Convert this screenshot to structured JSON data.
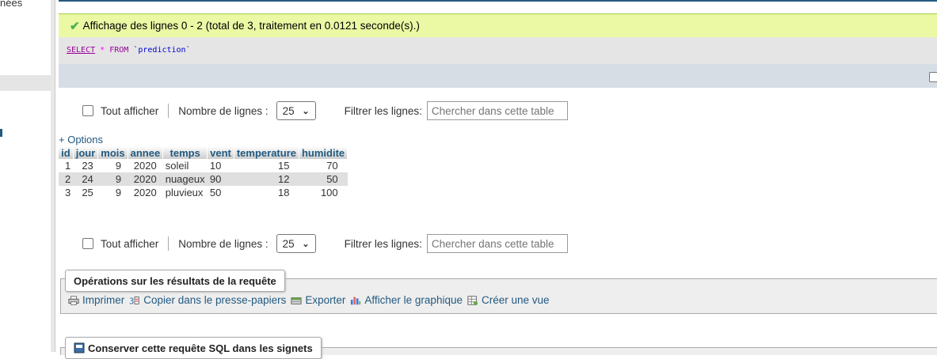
{
  "sidebar": {
    "partial_text": "nées"
  },
  "message": {
    "text": "Affichage des lignes 0 - 2 (total de 3, traitement en 0.0121 seconde(s).)"
  },
  "sql": {
    "select": "SELECT",
    "star": "*",
    "from": "FROM",
    "table": "`prediction`"
  },
  "nav": {
    "show_all": "Tout afficher",
    "rows_label": "Nombre de lignes :",
    "rows_value": "25",
    "filter_label": "Filtrer les lignes:",
    "filter_placeholder": "Chercher dans cette table"
  },
  "options_link": "+ Options",
  "table": {
    "headers": [
      "id",
      "jour",
      "mois",
      "annee",
      "temps",
      "vent",
      "temperature",
      "humidite"
    ],
    "rows": [
      [
        "1",
        "23",
        "9",
        "2020",
        "soleil",
        "10",
        "15",
        "70"
      ],
      [
        "2",
        "24",
        "9",
        "2020",
        "nuageux",
        "90",
        "12",
        "50"
      ],
      [
        "3",
        "25",
        "9",
        "2020",
        "pluvieux",
        "50",
        "18",
        "100"
      ]
    ]
  },
  "operations": {
    "legend": "Opérations sur les résultats de la requête",
    "print": "Imprimer",
    "copy": "Copier dans le presse-papiers",
    "export": "Exporter",
    "chart": "Afficher le graphique",
    "view": "Créer une vue"
  },
  "bookmark": {
    "legend": "Conserver cette requête SQL dans les signets"
  }
}
